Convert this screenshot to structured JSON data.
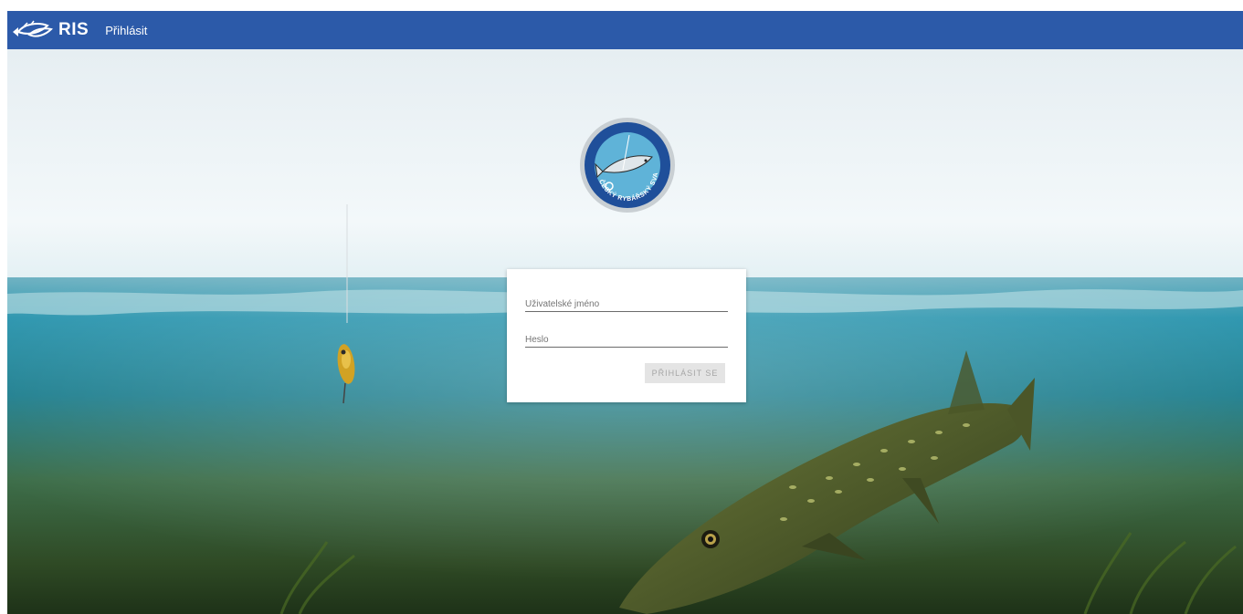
{
  "header": {
    "brand": "RIS",
    "login_link": "Přihlásit"
  },
  "logo": {
    "text": "ČESKÝ RYBÁŘSKÝ SVAZ"
  },
  "login_form": {
    "username_placeholder": "Uživatelské jméno",
    "password_placeholder": "Heslo",
    "submit_label": "PŘIHLÁSIT SE"
  },
  "colors": {
    "header": "#2c5aa9",
    "button_bg": "#e4e4e4",
    "button_text": "#a6a6a6"
  }
}
